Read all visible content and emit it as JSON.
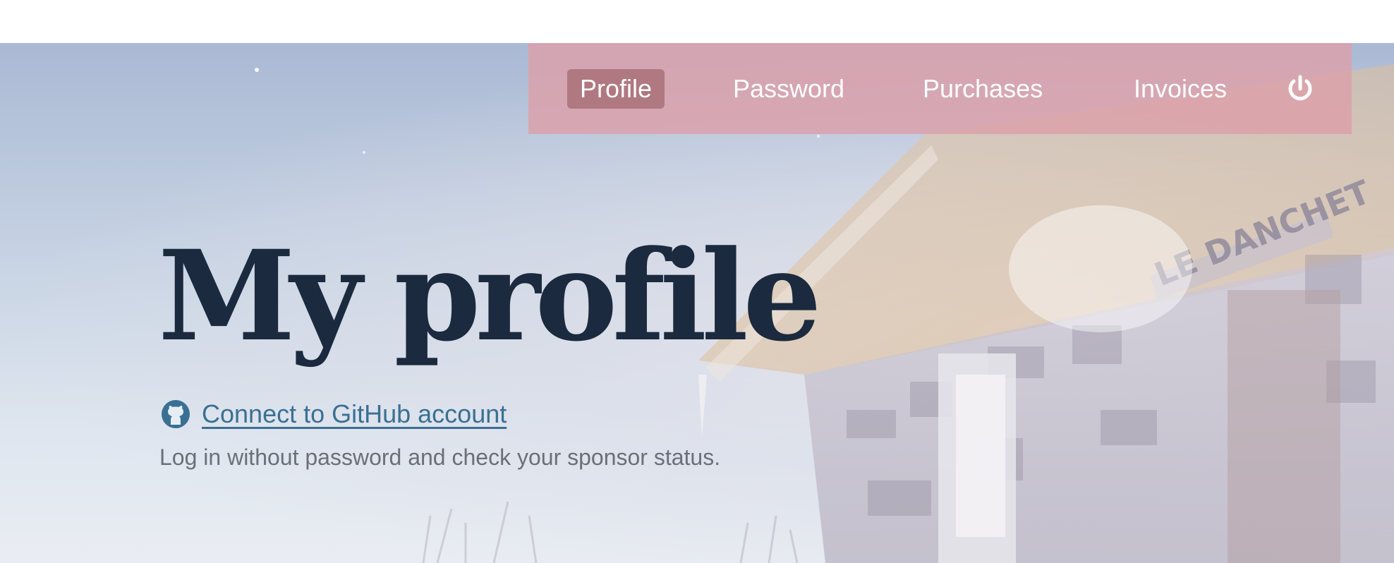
{
  "nav": {
    "items": [
      {
        "label": "Profile",
        "active": true
      },
      {
        "label": "Password",
        "active": false
      },
      {
        "label": "Purchases",
        "active": false
      },
      {
        "label": "Invoices",
        "active": false
      }
    ],
    "power_icon": "power-icon"
  },
  "main": {
    "title": "My profile",
    "github_icon": "github-icon",
    "github_link": "Connect to GitHub account",
    "subtitle": "Log in without password and check your sponsor status."
  },
  "background": {
    "sign_text": "LE DANCHET"
  },
  "colors": {
    "nav_bg": "#dca0aa",
    "nav_active": "#b07880",
    "title": "#1b2a3e",
    "link": "#3a7093",
    "subtitle": "#6b6f78"
  }
}
